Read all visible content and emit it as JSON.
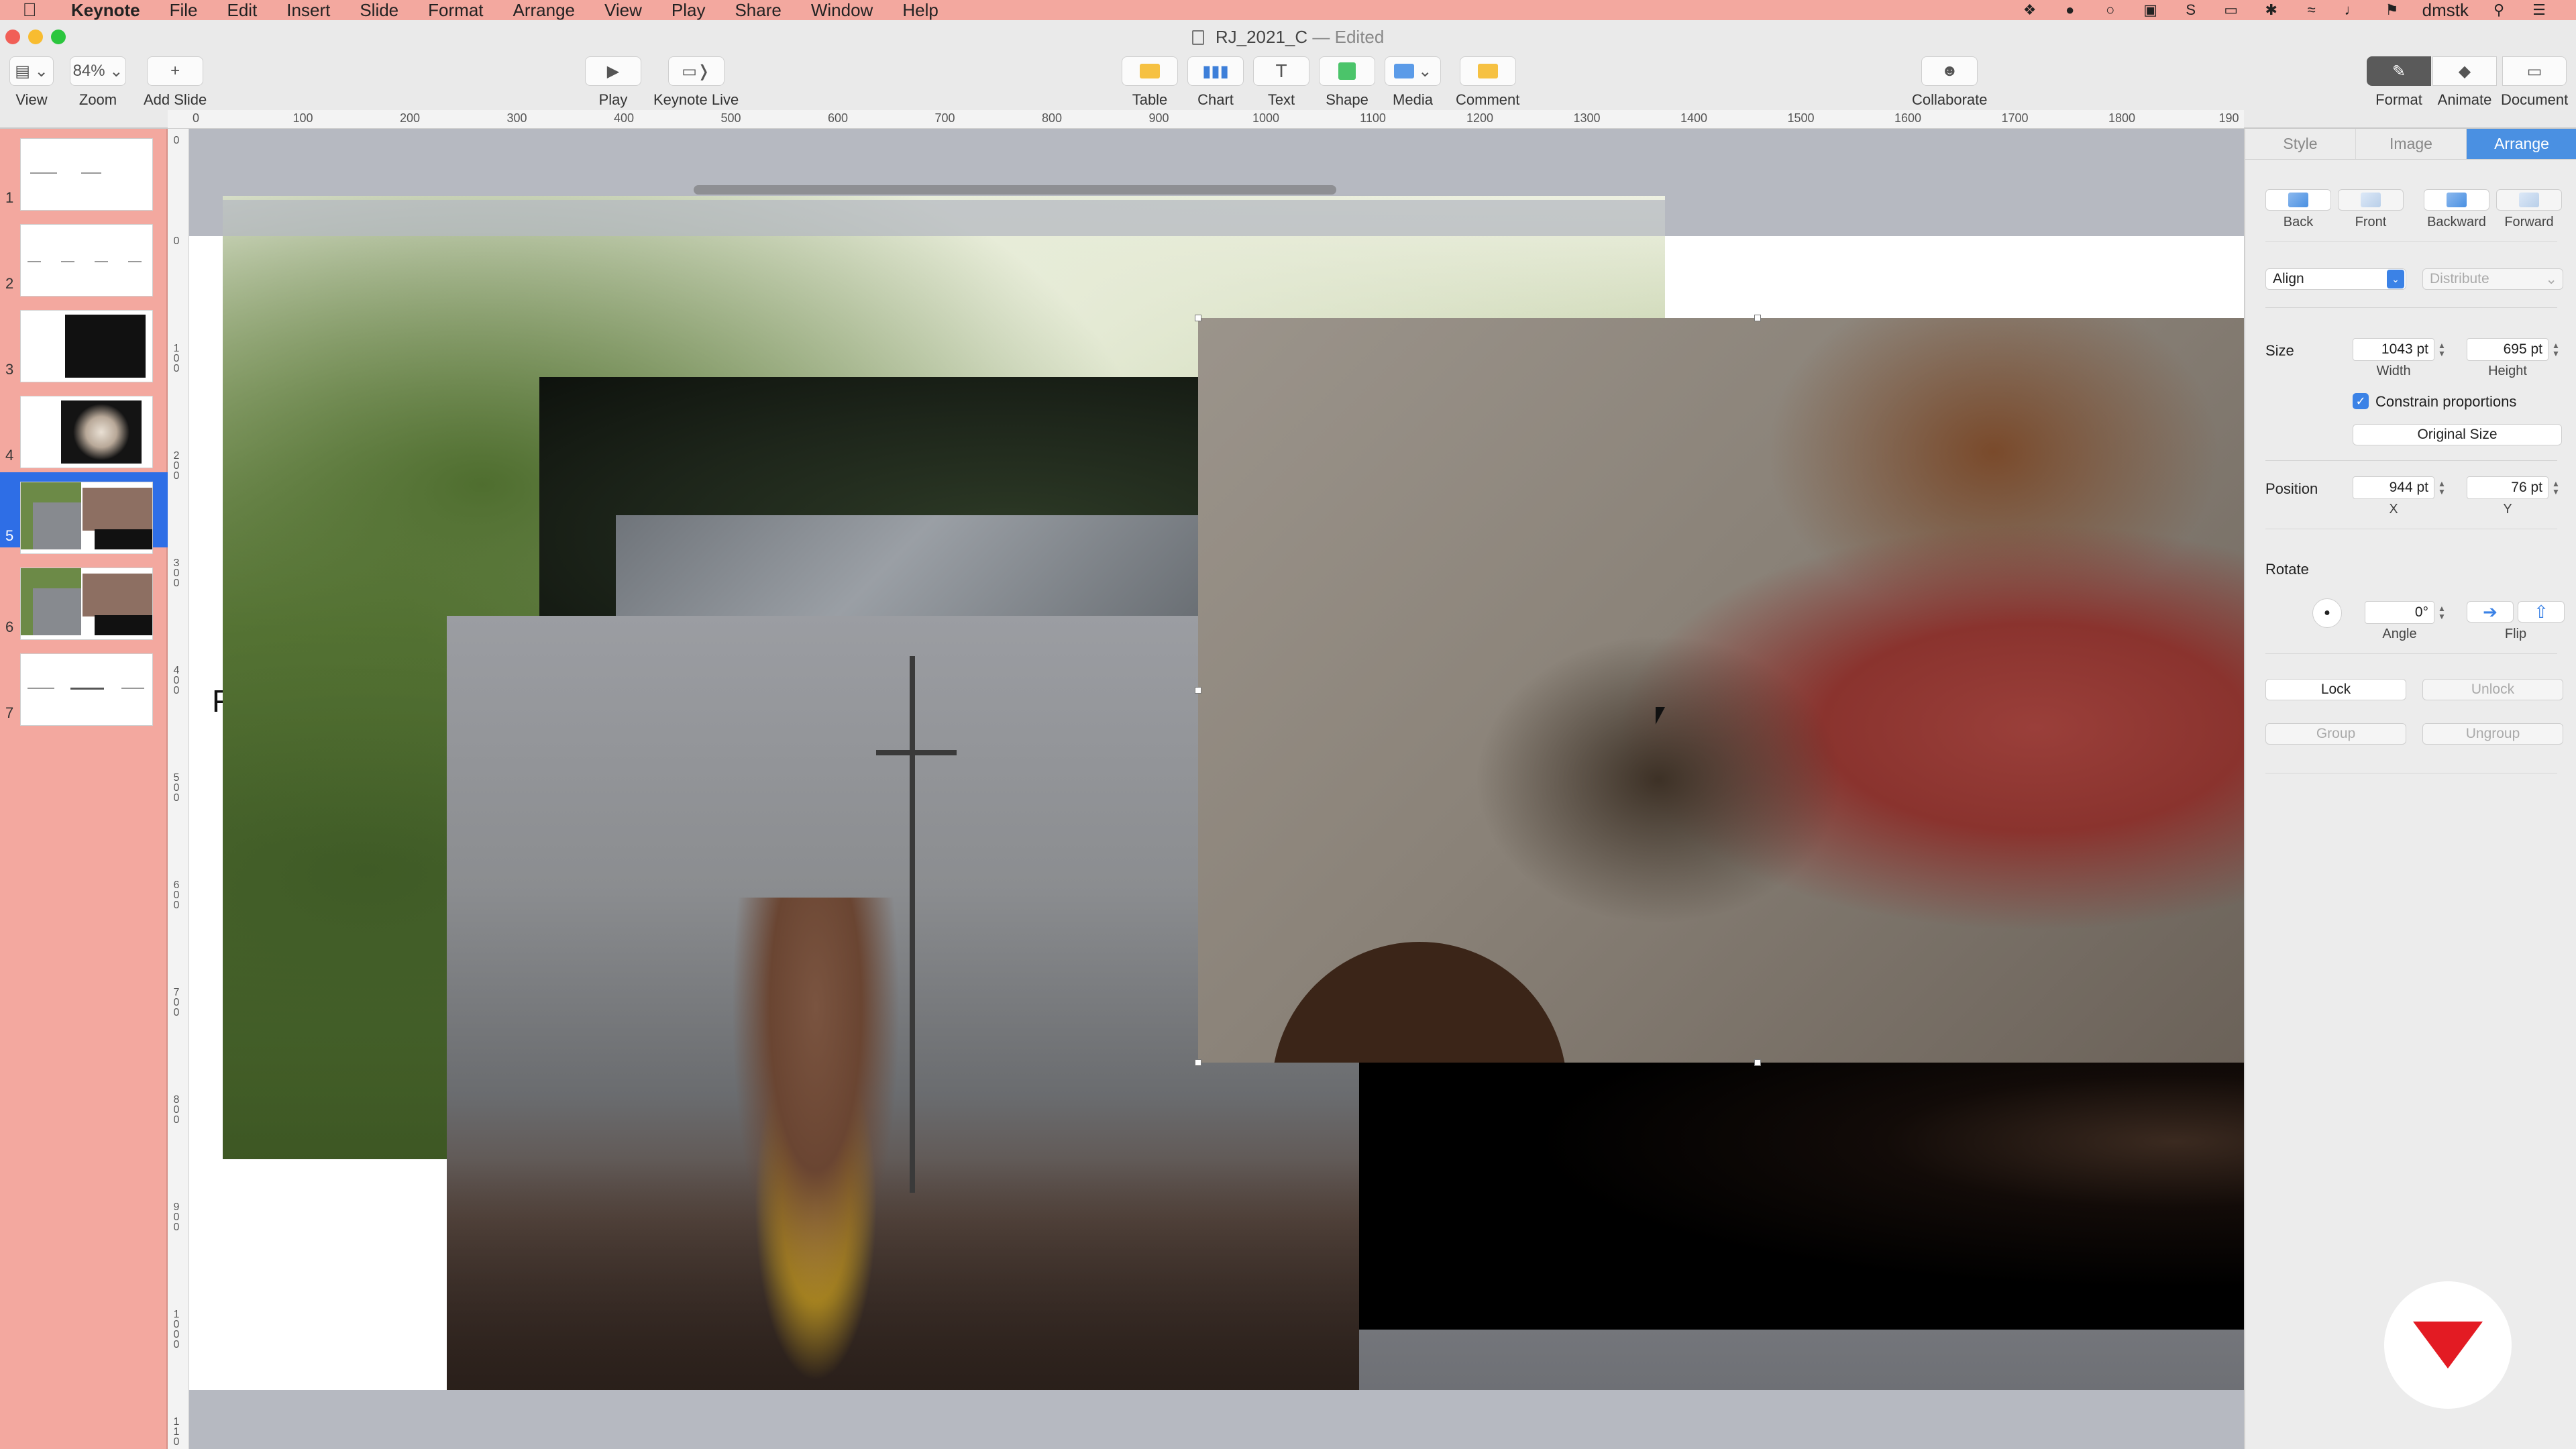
{
  "menubar": {
    "app_name": "Keynote",
    "items": [
      "File",
      "Edit",
      "Insert",
      "Slide",
      "Format",
      "Arrange",
      "View",
      "Play",
      "Share",
      "Window",
      "Help"
    ],
    "user": "dmstk"
  },
  "window": {
    "doc_name": "RJ_2021_C",
    "doc_status": "— Edited"
  },
  "toolbar": {
    "view": "View",
    "zoom": "Zoom",
    "zoom_value": "84%",
    "add_slide": "Add Slide",
    "play": "Play",
    "keynote_live": "Keynote Live",
    "table": "Table",
    "chart": "Chart",
    "text": "Text",
    "shape": "Shape",
    "media": "Media",
    "comment": "Comment",
    "collaborate": "Collaborate",
    "format": "Format",
    "animate": "Animate",
    "document": "Document"
  },
  "ruler": {
    "h_ticks": [
      "0",
      "100",
      "200",
      "300",
      "400",
      "500",
      "600",
      "700",
      "800",
      "900",
      "1000",
      "1100",
      "1200",
      "1300",
      "1400",
      "1500",
      "1600",
      "1700",
      "1800",
      "190"
    ],
    "v_ticks": [
      "0",
      "0",
      "100",
      "200",
      "300",
      "400",
      "500",
      "600",
      "700",
      "800",
      "900",
      "1000",
      "110"
    ]
  },
  "navigator": {
    "slides": [
      {
        "num": "1",
        "kind": "text"
      },
      {
        "num": "2",
        "kind": "text"
      },
      {
        "num": "3",
        "kind": "dark"
      },
      {
        "num": "4",
        "kind": "portrait"
      },
      {
        "num": "5",
        "kind": "collage",
        "selected": true
      },
      {
        "num": "6",
        "kind": "collage"
      },
      {
        "num": "7",
        "kind": "text"
      }
    ]
  },
  "inspector": {
    "tabs": [
      "Style",
      "Image",
      "Arrange"
    ],
    "active_tab": "Arrange",
    "order": {
      "back": "Back",
      "front": "Front",
      "backward": "Backward",
      "forward": "Forward"
    },
    "align": "Align",
    "distribute": "Distribute",
    "size": {
      "label": "Size",
      "width": "1043 pt",
      "height": "695 pt",
      "width_label": "Width",
      "height_label": "Height",
      "constrain": "Constrain proportions",
      "original_size": "Original Size"
    },
    "position": {
      "label": "Position",
      "x": "944 pt",
      "y": "76 pt",
      "x_label": "X",
      "y_label": "Y"
    },
    "rotate": {
      "label": "Rotate",
      "angle": "0°",
      "angle_label": "Angle",
      "flip_label": "Flip"
    },
    "lock": "Lock",
    "unlock": "Unlock",
    "group": "Group",
    "ungroup": "Ungroup"
  },
  "canvas": {
    "partial_text": "F"
  },
  "colors": {
    "desktop": "#f3a89f",
    "accent": "#4a90e2",
    "selection": "#2e6ee6",
    "brand": "#e31b23"
  }
}
